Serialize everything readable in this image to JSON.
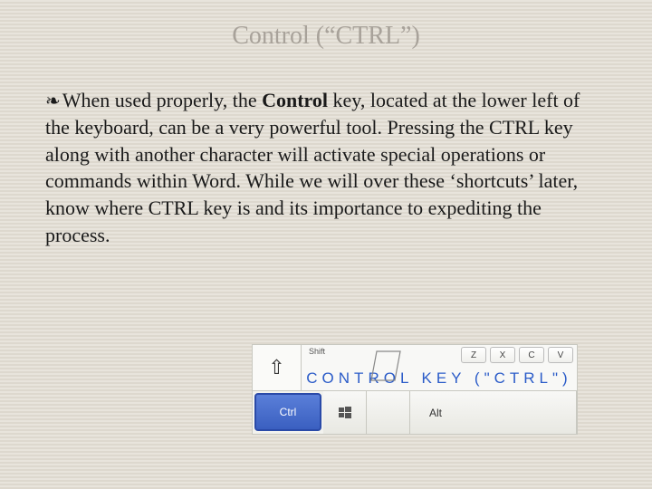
{
  "title": "Control (“CTRL”)",
  "body": {
    "bullet": "❧",
    "pre": "When used properly, the ",
    "bold": "Control",
    "post": " key, located at the lower left of the keyboard, can be a very powerful tool. Pressing the CTRL key along with another character will activate special operations or commands within Word.  While we will over these ‘shortcuts’ later, know where CTRL key is and its importance to expediting the process."
  },
  "keyboard": {
    "shift_arrow": "⇧",
    "shift_label": "Shift",
    "banner": "CONTROL KEY (\"CTRL\")",
    "top_caps": [
      "Z",
      "X",
      "C",
      "V"
    ],
    "ctrl": "Ctrl",
    "alt": "Alt"
  }
}
